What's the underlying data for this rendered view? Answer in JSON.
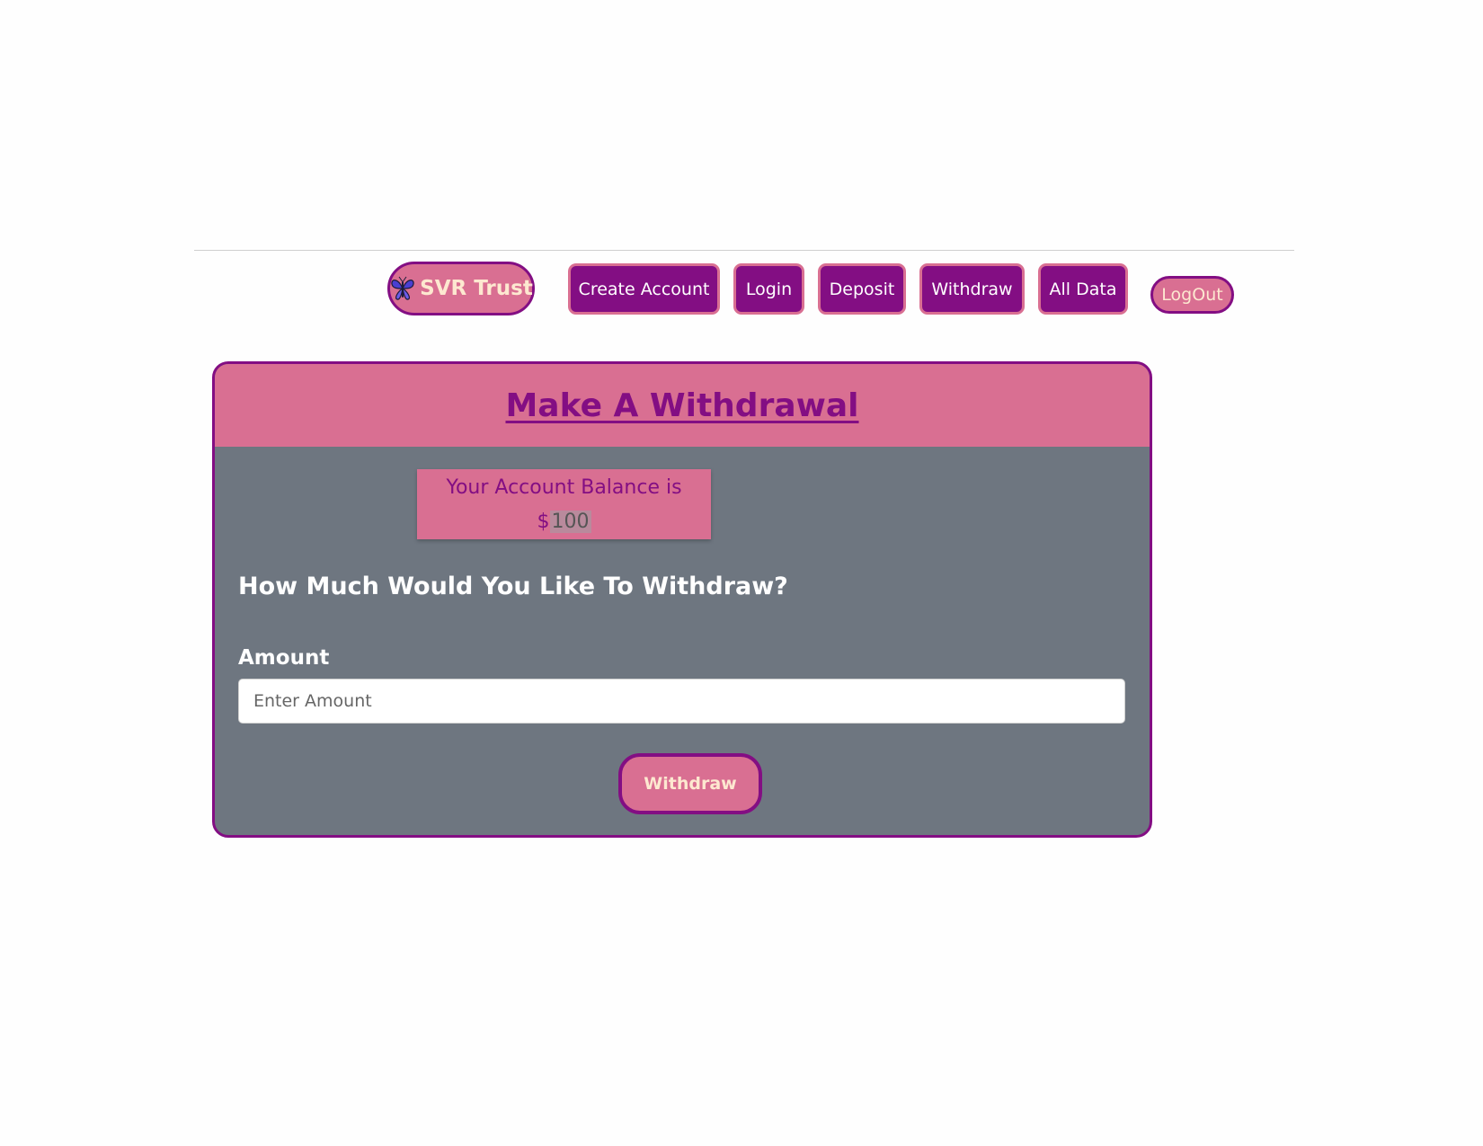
{
  "nav": {
    "brand_label": "SVR Trust",
    "brand_icon": "butterfly-icon",
    "items": [
      {
        "label": "Create Account"
      },
      {
        "label": "Login"
      },
      {
        "label": "Deposit"
      },
      {
        "label": "Withdraw"
      },
      {
        "label": "All Data"
      }
    ],
    "logout_label": "LogOut"
  },
  "card": {
    "title": "Make A Withdrawal",
    "balance_label": "Your Account Balance is",
    "balance_currency": "$",
    "balance_value": "100",
    "question": "How Much Would You Like To Withdraw?",
    "amount_label": "Amount",
    "amount_placeholder": "Enter Amount",
    "amount_value": "",
    "submit_label": "Withdraw"
  },
  "colors": {
    "accent_purple": "#830e83",
    "accent_pink": "#d96f92",
    "card_body": "#6e7680",
    "button_text": "#fde8d0"
  }
}
